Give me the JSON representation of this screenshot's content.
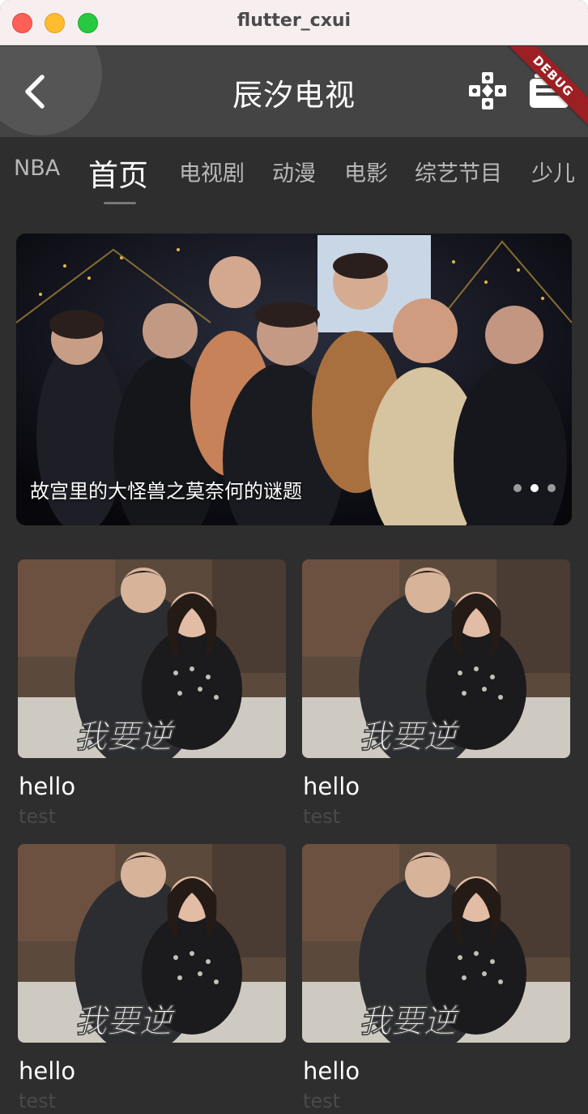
{
  "window": {
    "title": "flutter_cxui"
  },
  "appbar": {
    "title": "辰汐电视",
    "debug_label": "DEBUG"
  },
  "tabs": [
    {
      "label": "NBA",
      "active": false
    },
    {
      "label": "首页",
      "active": true
    },
    {
      "label": "电视剧",
      "active": false
    },
    {
      "label": "动漫",
      "active": false
    },
    {
      "label": "电影",
      "active": false
    },
    {
      "label": "综艺节目",
      "active": false
    },
    {
      "label": "少儿",
      "active": false
    }
  ],
  "banner": {
    "caption": "故宫里的大怪兽之莫奈何的谜题",
    "page_count": 3,
    "active_page": 2
  },
  "cards": [
    {
      "title": "hello",
      "subtitle": "test",
      "poster_text": "我要逆"
    },
    {
      "title": "hello",
      "subtitle": "test",
      "poster_text": "我要逆"
    },
    {
      "title": "hello",
      "subtitle": "test",
      "poster_text": "我要逆"
    },
    {
      "title": "hello",
      "subtitle": "test",
      "poster_text": "我要逆"
    }
  ],
  "icons": {
    "back": "chevron-left-icon",
    "game": "gamepad-icon",
    "list": "playlist-icon"
  },
  "colors": {
    "background": "#2e2e2e",
    "appbar": "#444444",
    "debug_banner": "#9c1f24"
  }
}
